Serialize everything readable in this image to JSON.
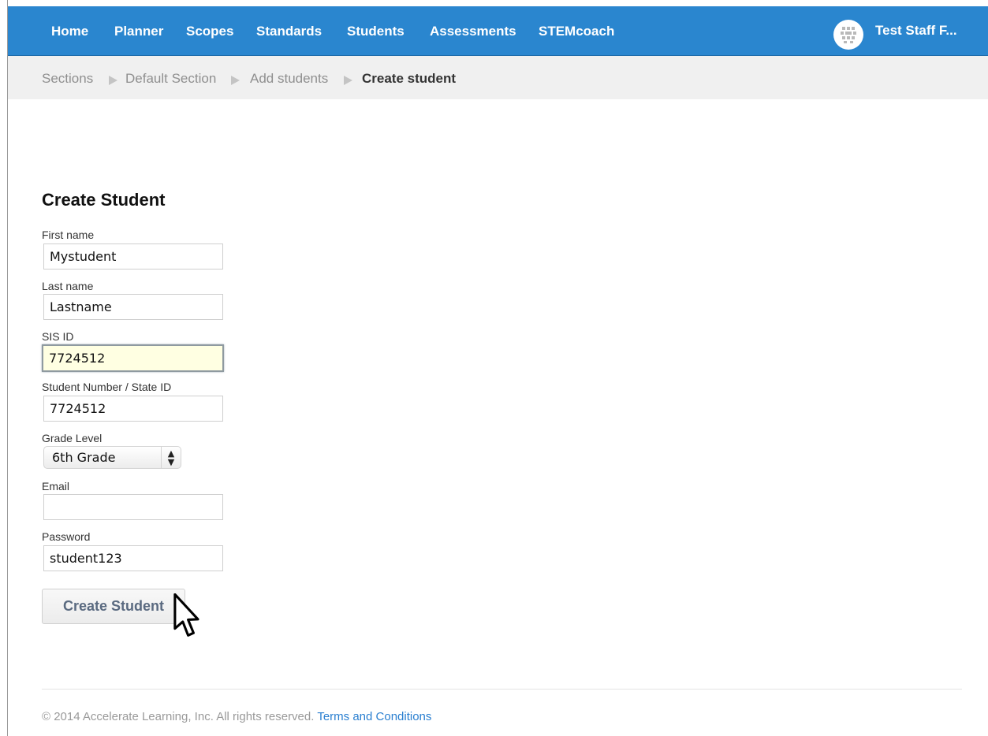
{
  "nav": {
    "items": [
      "Home",
      "Planner",
      "Scopes",
      "Standards",
      "Students",
      "Assessments",
      "STEMcoach"
    ],
    "user_name": "Test Staff F..."
  },
  "breadcrumb": {
    "items": [
      "Sections",
      "Default Section",
      "Add students"
    ],
    "current": "Create student"
  },
  "form": {
    "title": "Create Student",
    "first_name": {
      "label": "First name",
      "value": "Mystudent"
    },
    "last_name": {
      "label": "Last name",
      "value": "Lastname"
    },
    "sis_id": {
      "label": "SIS ID",
      "value": "7724512"
    },
    "student_number": {
      "label": "Student Number / State ID",
      "value": "7724512"
    },
    "grade_level": {
      "label": "Grade Level",
      "value": "6th Grade"
    },
    "email": {
      "label": "Email",
      "value": ""
    },
    "password": {
      "label": "Password",
      "value": "student123"
    },
    "submit_label": "Create Student"
  },
  "footer": {
    "copyright": "© 2014 Accelerate Learning, Inc. All rights reserved.",
    "terms_link": "Terms and Conditions"
  },
  "colors": {
    "navbar": "#2a86cf",
    "link": "#2a7fd0",
    "focused_field": "#ffffe2"
  }
}
